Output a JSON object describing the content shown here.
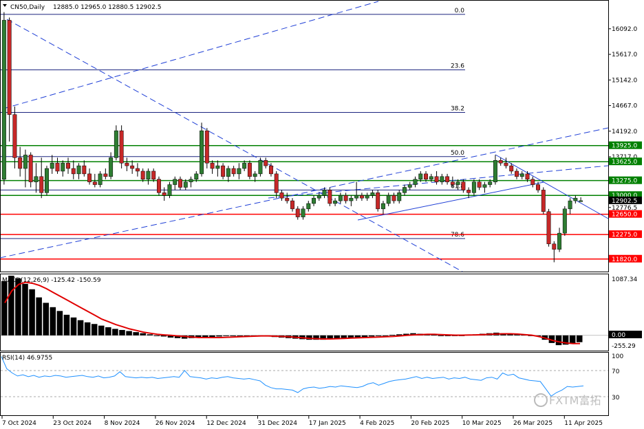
{
  "header": {
    "symbol": "CN50,Daily",
    "ohlc": "12885.0 12965.0 12880.5 12902.5"
  },
  "macd": {
    "label": "MACD(12,26,9) -125.42 -150.59",
    "axis_top": "1087.34",
    "axis_zero": "0.00",
    "axis_bottom": "-255.29"
  },
  "rsi": {
    "label": "RSI(14) 46.9755",
    "levels": [
      "100",
      "70",
      "30"
    ]
  },
  "watermark": "FXTM富拓",
  "x_labels": [
    "7 Oct 2024",
    "23 Oct 2024",
    "8 Nov 2024",
    "26 Nov 2024",
    "12 Dec 2024",
    "31 Dec 2024",
    "17 Jan 2025",
    "4 Feb 2025",
    "20 Feb 2025",
    "10 Mar 2025",
    "26 Mar 2025",
    "11 Apr 2025"
  ],
  "colors": {
    "up": "#2e7d32",
    "down": "#c62828",
    "support": "#ff0000",
    "resistance": "#008000",
    "fib": "#1a237e",
    "trend": "#1f3fd6",
    "signal": "#e00000",
    "rsi": "#1e90ff"
  },
  "chart_data": [
    {
      "type": "candlestick",
      "title": "CN50,Daily",
      "ylim": [
        11600,
        16600
      ],
      "y_ticks": [
        "16092.0",
        "15617.0",
        "15142.0",
        "14667.0",
        "14192.0",
        "13717.0",
        "12776.5"
      ],
      "price_tags": [
        {
          "label": "13925.0",
          "kind": "resistance",
          "value": 13925
        },
        {
          "label": "13625.0",
          "kind": "resistance",
          "value": 13625
        },
        {
          "label": "13275.0",
          "kind": "resistance",
          "value": 13275
        },
        {
          "label": "13000.0",
          "kind": "resistance",
          "value": 13000
        },
        {
          "label": "12902.5",
          "kind": "current",
          "value": 12902.5
        },
        {
          "label": "12650.0",
          "kind": "support",
          "value": 12650
        },
        {
          "label": "12275.0",
          "kind": "support",
          "value": 12275
        },
        {
          "label": "11820.0",
          "kind": "support",
          "value": 11820
        }
      ],
      "fib_levels": [
        {
          "label": "0.0",
          "value": 16360
        },
        {
          "label": "23.6",
          "value": 15330
        },
        {
          "label": "38.2",
          "value": 14540
        },
        {
          "label": "50.0",
          "value": 13720
        },
        {
          "label": "61.8",
          "value": 13100
        },
        {
          "label": "78.6",
          "value": 12200
        }
      ],
      "candles": [
        [
          13300,
          16400,
          13200,
          16250
        ],
        [
          16250,
          16300,
          14000,
          14500
        ],
        [
          14500,
          14650,
          13500,
          13700
        ],
        [
          13700,
          13900,
          13350,
          13500
        ],
        [
          13500,
          13850,
          13150,
          13750
        ],
        [
          13750,
          13800,
          13150,
          13250
        ],
        [
          13250,
          13600,
          13050,
          13350
        ],
        [
          13350,
          13700,
          12950,
          13050
        ],
        [
          13050,
          13550,
          13000,
          13500
        ],
        [
          13500,
          13750,
          13400,
          13600
        ],
        [
          13600,
          13700,
          13400,
          13450
        ],
        [
          13450,
          13650,
          13350,
          13600
        ],
        [
          13600,
          13700,
          13400,
          13500
        ],
        [
          13500,
          13650,
          13300,
          13400
        ],
        [
          13400,
          13600,
          13300,
          13550
        ],
        [
          13550,
          13650,
          13350,
          13400
        ],
        [
          13400,
          13500,
          13200,
          13250
        ],
        [
          13250,
          13400,
          13150,
          13200
        ],
        [
          13200,
          13450,
          13150,
          13400
        ],
        [
          13400,
          13500,
          13300,
          13350
        ],
        [
          13350,
          13800,
          13300,
          13700
        ],
        [
          13700,
          14300,
          13650,
          14200
        ],
        [
          14200,
          14300,
          13500,
          13600
        ],
        [
          13600,
          13700,
          13450,
          13550
        ],
        [
          13550,
          13650,
          13400,
          13500
        ],
        [
          13500,
          13600,
          13350,
          13450
        ],
        [
          13450,
          13500,
          13250,
          13300
        ],
        [
          13300,
          13500,
          13200,
          13450
        ],
        [
          13450,
          13500,
          13250,
          13300
        ],
        [
          13300,
          13350,
          13000,
          13050
        ],
        [
          13050,
          13150,
          12900,
          13000
        ],
        [
          13000,
          13250,
          12950,
          13200
        ],
        [
          13200,
          13350,
          13100,
          13300
        ],
        [
          13300,
          13350,
          13100,
          13150
        ],
        [
          13150,
          13300,
          13100,
          13250
        ],
        [
          13250,
          13350,
          13150,
          13300
        ],
        [
          13300,
          13450,
          13250,
          13400
        ],
        [
          13400,
          14350,
          13350,
          14200
        ],
        [
          14200,
          14250,
          13500,
          13600
        ],
        [
          13600,
          13650,
          13400,
          13500
        ],
        [
          13500,
          13650,
          13350,
          13550
        ],
        [
          13550,
          13600,
          13300,
          13350
        ],
        [
          13350,
          13550,
          13250,
          13500
        ],
        [
          13500,
          13550,
          13350,
          13400
        ],
        [
          13400,
          13600,
          13300,
          13500
        ],
        [
          13500,
          13650,
          13450,
          13600
        ],
        [
          13600,
          13650,
          13300,
          13350
        ],
        [
          13350,
          13450,
          13250,
          13400
        ],
        [
          13400,
          13700,
          13350,
          13650
        ],
        [
          13650,
          13700,
          13500,
          13550
        ],
        [
          13550,
          13600,
          13350,
          13400
        ],
        [
          13400,
          13450,
          12950,
          13050
        ],
        [
          13050,
          13100,
          12900,
          12950
        ],
        [
          12950,
          13050,
          12850,
          12900
        ],
        [
          12900,
          12950,
          12700,
          12750
        ],
        [
          12750,
          12800,
          12550,
          12600
        ],
        [
          12600,
          12800,
          12550,
          12750
        ],
        [
          12750,
          12900,
          12700,
          12850
        ],
        [
          12850,
          13000,
          12800,
          12950
        ],
        [
          12950,
          13050,
          12900,
          13000
        ],
        [
          13000,
          13150,
          12950,
          13100
        ],
        [
          13100,
          13150,
          12800,
          12850
        ],
        [
          12850,
          12950,
          12800,
          12900
        ],
        [
          12900,
          13050,
          12850,
          13000
        ],
        [
          13000,
          13050,
          12850,
          12900
        ],
        [
          12900,
          13000,
          12800,
          12950
        ],
        [
          12950,
          13250,
          12900,
          13000
        ],
        [
          13000,
          13050,
          12900,
          12950
        ],
        [
          12950,
          13050,
          12900,
          13000
        ],
        [
          13000,
          13100,
          12950,
          13050
        ],
        [
          13050,
          13100,
          12700,
          12750
        ],
        [
          12750,
          12900,
          12650,
          12850
        ],
        [
          12850,
          13050,
          12800,
          13000
        ],
        [
          13000,
          13050,
          12850,
          12900
        ],
        [
          12900,
          13100,
          12850,
          13050
        ],
        [
          13050,
          13200,
          13000,
          13150
        ],
        [
          13150,
          13250,
          13100,
          13200
        ],
        [
          13200,
          13350,
          13150,
          13300
        ],
        [
          13300,
          13450,
          13250,
          13400
        ],
        [
          13400,
          13450,
          13250,
          13300
        ],
        [
          13300,
          13400,
          13250,
          13350
        ],
        [
          13350,
          13450,
          13200,
          13250
        ],
        [
          13250,
          13400,
          13200,
          13350
        ],
        [
          13350,
          13400,
          13200,
          13250
        ],
        [
          13250,
          13350,
          13150,
          13200
        ],
        [
          13200,
          13300,
          13100,
          13250
        ],
        [
          13250,
          13300,
          13050,
          13100
        ],
        [
          13100,
          13150,
          12950,
          13050
        ],
        [
          13050,
          13300,
          13000,
          13250
        ],
        [
          13250,
          13300,
          13100,
          13150
        ],
        [
          13150,
          13250,
          13050,
          13200
        ],
        [
          13200,
          13300,
          13150,
          13250
        ],
        [
          13250,
          13750,
          13200,
          13650
        ],
        [
          13650,
          13700,
          13550,
          13600
        ],
        [
          13600,
          13700,
          13500,
          13550
        ],
        [
          13550,
          13600,
          13400,
          13450
        ],
        [
          13450,
          13500,
          13300,
          13350
        ],
        [
          13350,
          13450,
          13300,
          13400
        ],
        [
          13400,
          13450,
          13250,
          13300
        ],
        [
          13300,
          13350,
          13150,
          13200
        ],
        [
          13200,
          13250,
          13050,
          13100
        ],
        [
          13100,
          13150,
          12650,
          12700
        ],
        [
          12700,
          12750,
          12050,
          12100
        ],
        [
          12100,
          12150,
          11760,
          12000
        ],
        [
          12000,
          12400,
          11950,
          12300
        ],
        [
          12300,
          12800,
          12250,
          12750
        ],
        [
          12750,
          12950,
          12650,
          12900
        ],
        [
          12900,
          13000,
          12850,
          12950
        ],
        [
          12885,
          12965,
          12880.5,
          12902.5
        ]
      ]
    },
    {
      "type": "bar",
      "title": "MACD(12,26,9)",
      "ylim": [
        -255.29,
        1087.34
      ],
      "histogram": [
        1000,
        1100,
        1050,
        950,
        850,
        700,
        600,
        520,
        450,
        380,
        330,
        280,
        240,
        210,
        180,
        150,
        120,
        100,
        80,
        60,
        40,
        20,
        0,
        -20,
        -40,
        -50,
        -60,
        -50,
        -40,
        -30,
        -30,
        -20,
        -10,
        -10,
        0,
        0,
        0,
        -10,
        -20,
        -30,
        -40,
        -50,
        -60,
        -70,
        -80,
        -80,
        -80,
        -70,
        -60,
        -50,
        -50,
        -40,
        -30,
        -20,
        -10,
        0,
        10,
        20,
        30,
        40,
        30,
        20,
        10,
        0,
        -10,
        -10,
        0,
        10,
        20,
        30,
        40,
        50,
        40,
        30,
        20,
        10,
        0,
        -20,
        -80,
        -140,
        -180,
        -170,
        -150,
        -125
      ],
      "signal": [
        600,
        820,
        940,
        980,
        960,
        920,
        860,
        790,
        720,
        650,
        580,
        510,
        440,
        370,
        300,
        250,
        200,
        160,
        120,
        90,
        60,
        40,
        20,
        10,
        0,
        -10,
        -20,
        -30,
        -40,
        -40,
        -40,
        -40,
        -35,
        -30,
        -25,
        -20,
        -15,
        -10,
        -10,
        -15,
        -20,
        -25,
        -35,
        -45,
        -55,
        -60,
        -65,
        -65,
        -60,
        -55,
        -50,
        -45,
        -40,
        -35,
        -30,
        -25,
        -20,
        -10,
        0,
        10,
        15,
        20,
        20,
        15,
        10,
        5,
        5,
        8,
        10,
        15,
        20,
        25,
        30,
        30,
        25,
        15,
        5,
        -20,
        -50,
        -90,
        -120,
        -140,
        -150,
        -150.59
      ]
    },
    {
      "type": "line",
      "title": "RSI(14)",
      "ylim": [
        0,
        100
      ],
      "values": [
        95,
        75,
        68,
        63,
        65,
        62,
        64,
        61,
        63,
        62,
        64,
        63,
        61,
        62,
        63,
        64,
        62,
        61,
        63,
        60,
        61,
        63,
        70,
        62,
        61,
        60,
        61,
        60,
        61,
        59,
        60,
        61,
        62,
        61,
        72,
        62,
        61,
        60,
        58,
        60,
        59,
        61,
        62,
        60,
        59,
        58,
        59,
        57,
        55,
        48,
        44,
        42,
        42,
        41,
        40,
        36,
        42,
        44,
        45,
        43,
        44,
        46,
        45,
        47,
        46,
        45,
        44,
        46,
        50,
        52,
        48,
        51,
        54,
        56,
        57,
        58,
        60,
        62,
        59,
        61,
        59,
        60,
        61,
        58,
        60,
        59,
        61,
        58,
        57,
        56,
        60,
        61,
        58,
        68,
        64,
        66,
        60,
        58,
        56,
        55,
        54,
        42,
        30,
        36,
        40,
        46,
        45,
        46,
        47
      ]
    }
  ]
}
